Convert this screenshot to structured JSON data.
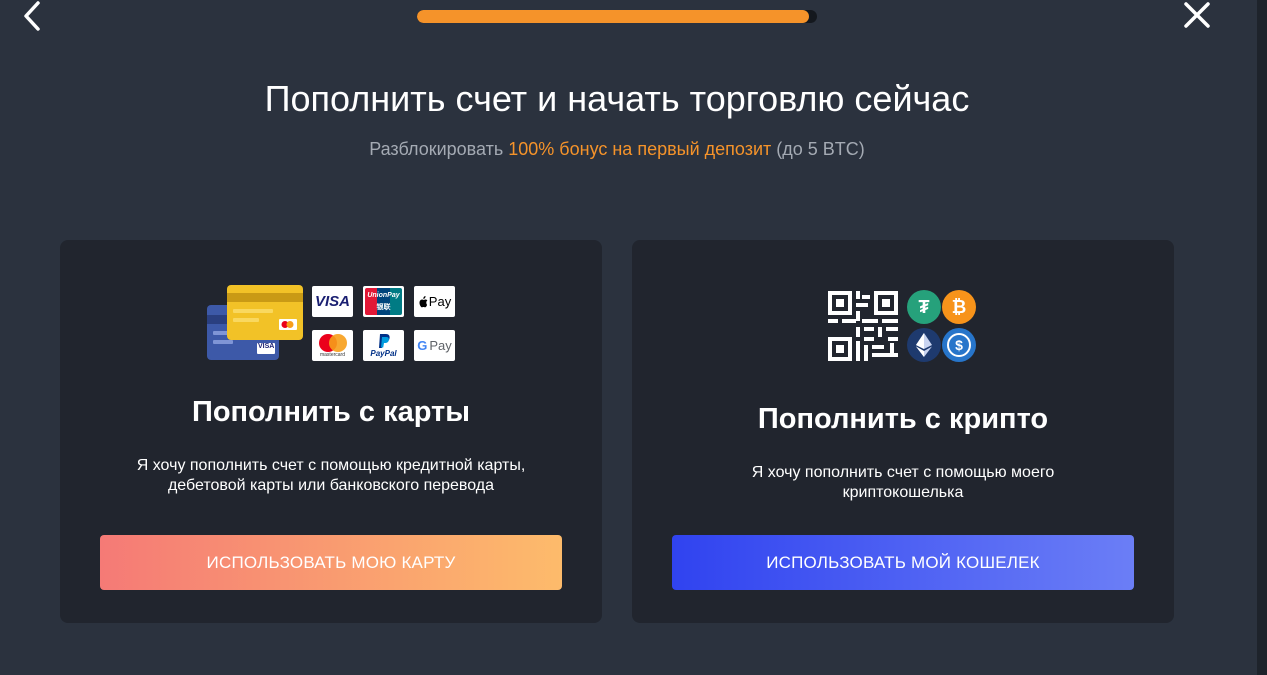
{
  "header": {
    "progress_fraction": 0.98
  },
  "main": {
    "title": "Пополнить счет и начать торговлю сейчас",
    "subtitle": {
      "prefix": "Разблокировать ",
      "accent": "100% бонус на первый депозит",
      "suffix": " (до 5 BTC)"
    }
  },
  "card_option": {
    "title": "Пополнить с карты",
    "description": "Я хочу пополнить счет с помощью кредитной карты, дебетовой карты или банковского перевода",
    "button_label": "ИСПОЛЬЗОВАТЬ МОЮ КАРТУ",
    "logos": {
      "visa": "VISA",
      "unionpay": "UnionPay",
      "unionpay_sub": "银联",
      "applepay": "Pay",
      "mastercard": "mastercard",
      "paypal": "PayPal",
      "googlepay": "Pay",
      "card_brand": "VISA"
    }
  },
  "crypto_option": {
    "title": "Пополнить с крипто",
    "description": "Я хочу пополнить счет с помощью моего криптокошелька",
    "button_label": "ИСПОЛЬЗОВАТЬ МОЙ КОШЕЛЕК",
    "coins": {
      "tether": "₮",
      "bitcoin": "₿",
      "usdc": "$"
    }
  },
  "colors": {
    "accent_orange": "#f5932a",
    "background": "#2b323e",
    "card_bg": "#21252e"
  }
}
